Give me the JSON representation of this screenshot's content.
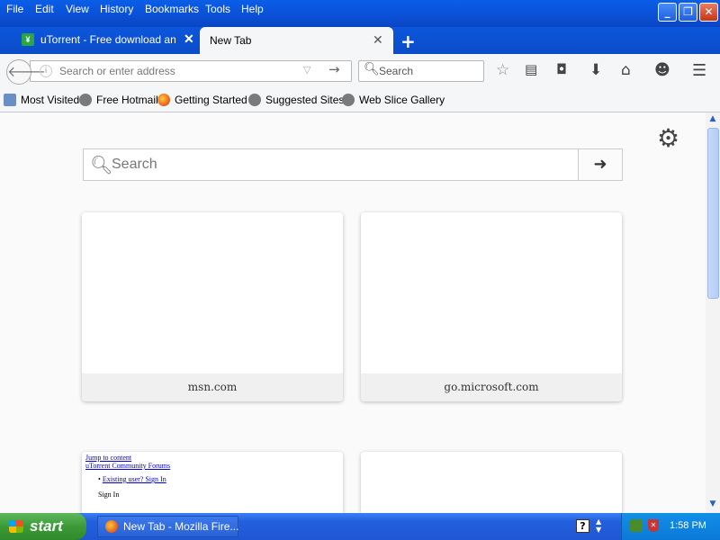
{
  "menu": {
    "items": [
      "File",
      "Edit",
      "View",
      "History",
      "Bookmarks",
      "Tools",
      "Help"
    ]
  },
  "window_buttons": {
    "minimize": "_",
    "restore": "❐",
    "close": "✕"
  },
  "tabs": [
    {
      "title": "uTorrent - Free download an...",
      "icon": "utorrent-icon",
      "close": "✕",
      "active": false
    },
    {
      "title": "New Tab",
      "close": "✕",
      "active": true
    }
  ],
  "new_tab_button": "+",
  "navbar": {
    "url_placeholder": "Search or enter address",
    "url_value": "",
    "search_placeholder": "Search",
    "icons": [
      "back-icon",
      "info-icon",
      "dropdown-icon",
      "go-icon",
      "search-icon",
      "bookmark-star-icon",
      "reading-list-icon",
      "pocket-icon",
      "download-icon",
      "home-icon",
      "smiley-icon",
      "menu-icon"
    ]
  },
  "bookmarks": [
    {
      "label": "Most Visited",
      "icon": "most-visited-icon"
    },
    {
      "label": "Free Hotmail",
      "icon": "globe-icon"
    },
    {
      "label": "Getting Started",
      "icon": "firefox-icon"
    },
    {
      "label": "Suggested Sites",
      "icon": "globe-icon"
    },
    {
      "label": "Web Slice Gallery",
      "icon": "globe-icon"
    }
  ],
  "newtab": {
    "search_placeholder": "Search",
    "tiles": [
      {
        "label": "msn.com"
      },
      {
        "label": "go.microsoft.com"
      },
      {
        "label": "",
        "thumbnail": {
          "line1": "Jump to content",
          "line2": "uTorrent Community Forums",
          "line3": "Existing user? Sign In",
          "line4": "Sign In"
        }
      },
      {
        "label": ""
      }
    ]
  },
  "taskbar": {
    "start_label": "start",
    "window_button": "New Tab - Mozilla Fire...",
    "clock": "1:58 PM",
    "help_glyph": "?"
  },
  "colors": {
    "titlebar": "#0b4fd6",
    "taskbar": "#2360de",
    "start": "#3b9a37",
    "tray": "#0b78d8"
  }
}
